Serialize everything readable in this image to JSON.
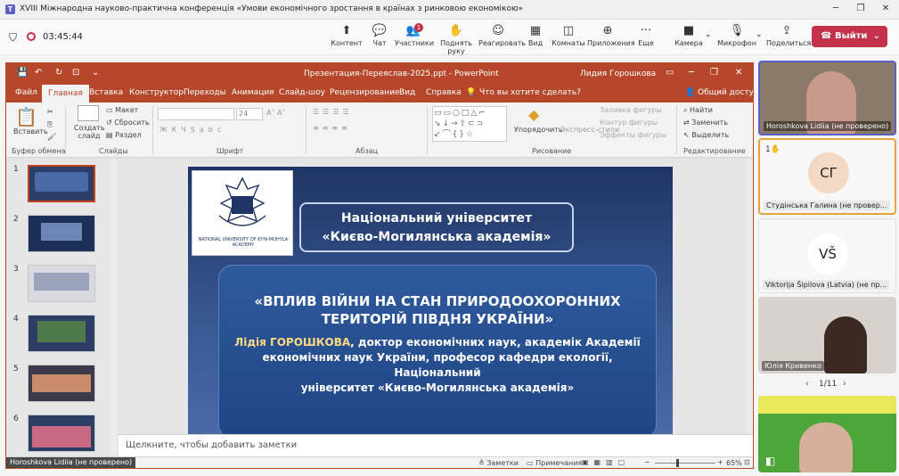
{
  "window": {
    "title": "XVIII Міжнародна науково-практична конференція «Умови економічного зростання в країнах з ринковою економікою»"
  },
  "call": {
    "timer": "03:45:44",
    "controls": [
      {
        "label": "Контент",
        "icon": "share-screen-icon"
      },
      {
        "label": "Чат",
        "icon": "chat-icon"
      },
      {
        "label": "Участники",
        "icon": "people-icon",
        "badge": "1"
      },
      {
        "label": "Поднять руку",
        "icon": "raise-hand-icon"
      },
      {
        "label": "Реагировать",
        "icon": "react-icon"
      },
      {
        "label": "Вид",
        "icon": "view-icon"
      },
      {
        "label": "Комнаты",
        "icon": "rooms-icon"
      },
      {
        "label": "Приложения",
        "icon": "apps-icon"
      },
      {
        "label": "Еще",
        "icon": "more-icon"
      }
    ],
    "camera_label": "Камера",
    "mic_label": "Микрофон",
    "share_label": "Поделиться",
    "leave_label": "Выйти"
  },
  "ppt": {
    "title": "Презентация-Переяслав-2025.ppt - PowerPoint",
    "user": "Лидия Горошкова",
    "tabs": [
      "Файл",
      "Главная",
      "Вставка",
      "Конструктор",
      "Переходы",
      "Анимация",
      "Слайд-шоу",
      "Рецензирование",
      "Вид",
      "Справка"
    ],
    "active_tab": "Главная",
    "tell_me": "Что вы хотите сделать?",
    "share_label": "Общий доступ",
    "ribbon": {
      "paste": "Вставить",
      "clipboard": "Буфер обмена",
      "create_slide": "Создать слайд",
      "layout": "Макет",
      "reset": "Сбросить",
      "section": "Раздел",
      "slides": "Слайды",
      "font_size": "24",
      "font_group": "Шрифт",
      "paragraph_group": "Абзац",
      "arrange": "Упорядочить",
      "quick_styles": "Экспресс-стили",
      "shape_fill": "Заливка фигуры",
      "shape_outline": "Контур фигуры",
      "shape_effects": "Эффекты фигуры",
      "drawing_group": "Рисование",
      "find": "Найти",
      "replace": "Заменить",
      "select": "Выделить",
      "editing_group": "Редактирование"
    },
    "thumbnails": [
      "1",
      "2",
      "3",
      "4",
      "5",
      "6"
    ],
    "slide": {
      "university_line1": "Національний університет",
      "university_line2": "«Києво-Могилянська академія»",
      "logo_text": "NATIONAL UNIVERSITY OF KYIV-MOHYLA ACADEMY",
      "headline_line1": "«ВПЛИВ ВІЙНИ НА СТАН ПРИРОДООХОРОННИХ",
      "headline_line2": "ТЕРИТОРІЙ ПІВДНЯ УКРАЇНИ»",
      "author_name": "Лідія ГОРОШКОВА",
      "author_line1": ", доктор економічних наук, академік Академії",
      "author_line2": "економічних наук України, професор кафедри екології, Національний",
      "author_line3": "університет «Києво-Могилянська академія»"
    },
    "notes_placeholder": "Щелкните, чтобы добавить заметки",
    "status": {
      "slide_info": "Horoshkova Lidiia (не проверено)",
      "notes_btn": "Заметки",
      "comments_btn": "Примечания",
      "zoom": "65%"
    }
  },
  "participants": [
    {
      "name": "Horoshkova Lidiia (не проверено)",
      "type": "video"
    },
    {
      "name": "Студінська Галина (не провер...",
      "initials": "СГ",
      "type": "avatar",
      "hand": "1"
    },
    {
      "name": "Viktorija Šipilova (Latvia) (не пр...",
      "initials": "VŠ",
      "type": "avatar"
    },
    {
      "name": "Юлія Кривенко",
      "type": "video"
    }
  ],
  "pager": "1/11"
}
